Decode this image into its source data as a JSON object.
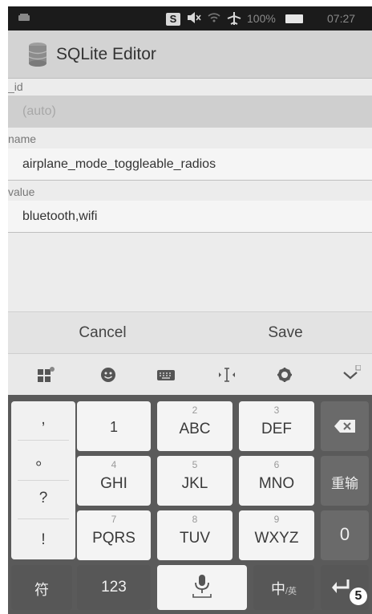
{
  "status_bar": {
    "s_icon": "S",
    "icons": [
      "notification-icon",
      "mute-icon",
      "wifi-icon",
      "airplane-icon",
      "battery-icon"
    ],
    "battery": "100%",
    "time": "07:27"
  },
  "app": {
    "title": "SQLite Editor"
  },
  "form": {
    "fields": [
      {
        "label": "_id",
        "value": "(auto)",
        "editable": false
      },
      {
        "label": "name",
        "value": "airplane_mode_toggleable_radios",
        "editable": true
      },
      {
        "label": "value",
        "value": "bluetooth,wifi",
        "editable": true
      }
    ]
  },
  "dialog": {
    "cancel": "Cancel",
    "save": "Save"
  },
  "ime_toolbar": {
    "icons": [
      "app-grid-icon",
      "emoji-icon",
      "keyboard-icon",
      "cursor-move-icon",
      "settings-icon",
      "collapse-chevron-icon"
    ]
  },
  "keyboard": {
    "punctuation": [
      ",",
      "。",
      "?",
      "!"
    ],
    "keys": [
      {
        "digit": "",
        "letters": "1"
      },
      {
        "digit": "2",
        "letters": "ABC"
      },
      {
        "digit": "3",
        "letters": "DEF"
      },
      {
        "digit": "4",
        "letters": "GHI"
      },
      {
        "digit": "5",
        "letters": "JKL"
      },
      {
        "digit": "6",
        "letters": "MNO"
      },
      {
        "digit": "7",
        "letters": "PQRS"
      },
      {
        "digit": "8",
        "letters": "TUV"
      },
      {
        "digit": "9",
        "letters": "WXYZ"
      }
    ],
    "reenter": "重输",
    "zero": "0",
    "symbols": "符",
    "numbers": "123",
    "lang_main": "中",
    "lang_sub": "/英",
    "annotation": "5"
  },
  "colors": {
    "status_bar_bg": "#1b1b1b",
    "action_bar_bg": "#d3d3d3",
    "keypad_bg": "#5a5a5a",
    "key_bg": "#f4f4f4"
  }
}
